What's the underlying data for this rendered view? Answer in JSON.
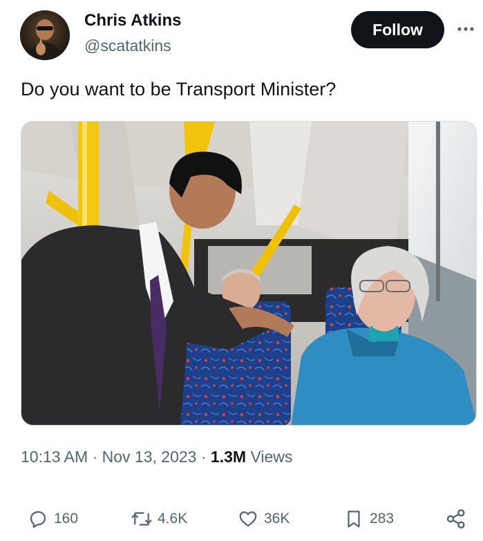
{
  "author": {
    "display_name": "Chris Atkins",
    "handle": "@scatatkins"
  },
  "follow_label": "Follow",
  "tweet": {
    "text": "Do you want to be Transport Minister?"
  },
  "meta": {
    "time": "10:13 AM",
    "separator": "·",
    "date": "Nov 13, 2023",
    "views_count": "1.3M",
    "views_label": "Views"
  },
  "actions": {
    "replies": "160",
    "reposts": "4.6K",
    "likes": "36K",
    "bookmarks": "283"
  },
  "colors": {
    "text_primary": "#0f1419",
    "text_secondary": "#536471",
    "follow_bg": "#0f1419",
    "border": "#cfd9de"
  }
}
